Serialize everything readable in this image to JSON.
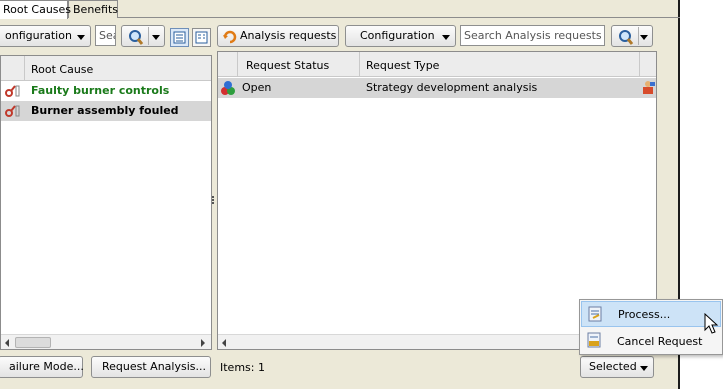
{
  "tabs": [
    {
      "label": "Root Causes",
      "active": true
    },
    {
      "label": "Benefits",
      "active": false
    }
  ],
  "left_toolbar": {
    "config_dropdown": "onfiguration",
    "search_text": "Sea"
  },
  "right_toolbar": {
    "requests_dropdown": "Analysis requests",
    "config_dropdown": "Configuration",
    "search_placeholder": "Search Analysis requests (Ct"
  },
  "root_causes": {
    "column_header": "Root Cause",
    "rows": [
      {
        "label": "Faulty burner controls",
        "color": "#1a7a1a",
        "selected": false
      },
      {
        "label": "Burner assembly fouled",
        "color": "#000000",
        "selected": true
      }
    ]
  },
  "requests": {
    "columns": [
      "Request Status",
      "Request Type"
    ],
    "rows": [
      {
        "status": "Open",
        "type": "Strategy development analysis"
      }
    ],
    "items_label": "Items: 1"
  },
  "footer": {
    "failure_modes_button": "ailure Mode...",
    "request_analysis_button": "Request Analysis...",
    "selected_dropdown": "Selected"
  },
  "context_menu": {
    "items": [
      {
        "label": "Process...",
        "highlighted": true,
        "icon": "process-icon"
      },
      {
        "label": "Cancel Request",
        "highlighted": false,
        "icon": "cancel-request-icon"
      }
    ]
  },
  "colors": {
    "selection": "#d6d6d6",
    "menu_highlight": "#cde3f7",
    "header_bg": "#ececec"
  }
}
